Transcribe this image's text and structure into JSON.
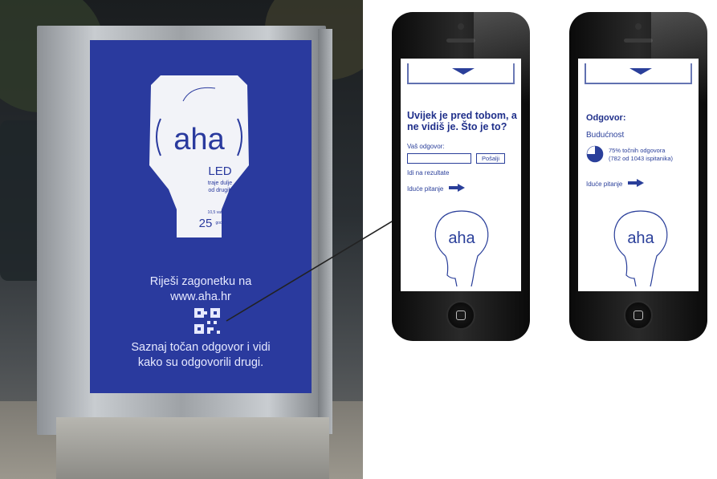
{
  "poster": {
    "logo": "aha",
    "product": "LED",
    "tagline_1": "traje dulje",
    "tagline_2": "od drugih",
    "wattage": "10,5 vati",
    "lifetime_value": "25",
    "lifetime_unit": "godina",
    "riddle_line1": "Riješi zagonetku na",
    "riddle_line2": "www.aha.hr",
    "cta_line1": "Saznaj točan odgovor i vidi",
    "cta_line2": "kako su odgovorili drugi."
  },
  "phone_question": {
    "question": "Uvijek je pred tobom, a ne vidiš je. Što je to?",
    "answer_label": "Vaš odgovor:",
    "answer_value": "",
    "send_label": "Pošalji",
    "results_link": "Idi na rezultate",
    "next_link": "Iduće pitanje",
    "logo": "aha"
  },
  "phone_answer": {
    "answer_title": "Odgovor:",
    "answer_value": "Budućnost",
    "stat_line1": "75% točnih odgovora",
    "stat_line2": "(782 od 1043 ispitanika)",
    "correct_fraction": 0.75,
    "next_link": "Iduće pitanje",
    "logo": "aha"
  },
  "colors": {
    "brand_blue": "#2a3a9e",
    "text_blue": "#1f2f8a"
  }
}
